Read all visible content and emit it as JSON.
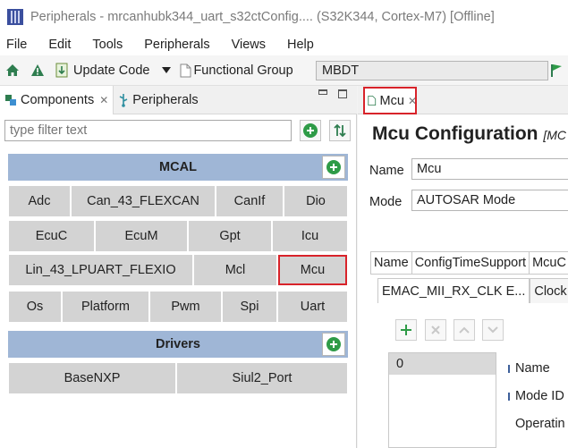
{
  "window": {
    "title": "Peripherals - mrcanhubk344_uart_s32ctConfig.... (S32K344, Cortex-M7) [Offline]"
  },
  "menu": [
    "File",
    "Edit",
    "Tools",
    "Peripherals",
    "Views",
    "Help"
  ],
  "toolbar": {
    "update_code": "Update Code",
    "functional_group_label": "Functional Group",
    "functional_group_value": "MBDT"
  },
  "left_tabs": {
    "components": "Components",
    "peripherals": "Peripherals"
  },
  "filter": {
    "placeholder": "type filter text"
  },
  "groups": {
    "mcal": {
      "title": "MCAL",
      "components": [
        "Adc",
        "Can_43_FLEXCAN",
        "CanIf",
        "Dio",
        "EcuC",
        "EcuM",
        "Gpt",
        "Icu",
        "Lin_43_LPUART_FLEXIO",
        "Mcl",
        "Mcu",
        "Os",
        "Platform",
        "Pwm",
        "Spi",
        "Uart"
      ]
    },
    "drivers": {
      "title": "Drivers",
      "components": [
        "BaseNXP",
        "Siul2_Port"
      ]
    }
  },
  "editor": {
    "tab_label": "Mcu",
    "title": "Mcu Configuration",
    "title_suffix": "[MC",
    "name_label": "Name",
    "name_value": "Mcu",
    "mode_label": "Mode",
    "mode_value": "AUTOSAR Mode",
    "table_headers": [
      "Name",
      "ConfigTimeSupport",
      "McuC"
    ],
    "subtabs": [
      "EMAC_MII_RX_CLK E...",
      "Clock Fai"
    ],
    "list_items": [
      "0"
    ],
    "properties": [
      "Name",
      "Mode ID",
      "Operatin"
    ]
  },
  "colors": {
    "group_header": "#9fb6d6",
    "component_button": "#d3d3d3",
    "highlight": "#d8232a",
    "accent_green": "#2e9b47"
  }
}
